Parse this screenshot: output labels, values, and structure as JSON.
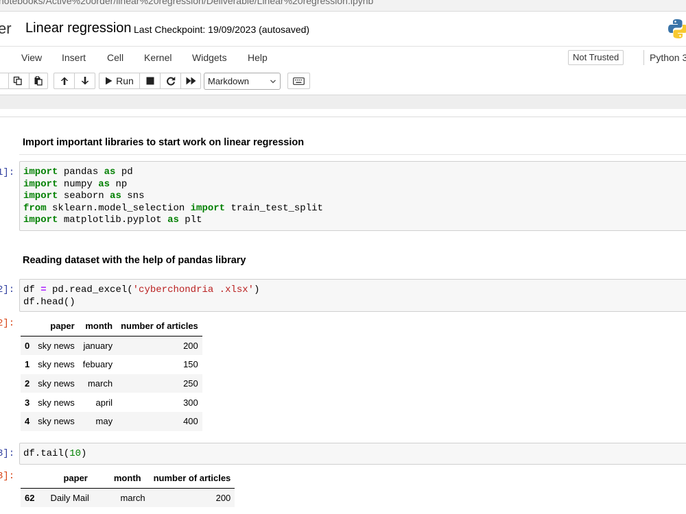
{
  "browser": {
    "url_path": "notebooks/Active%20order/linear%20regression/Deliverable/Linear%20regression.ipynb"
  },
  "header": {
    "logo_text": "er",
    "notebook_title": "Linear regression",
    "checkpoint": "Last Checkpoint: 19/09/2023  (autosaved)",
    "python_logo_icon": "python-logo-icon"
  },
  "menu": {
    "items": [
      "View",
      "Insert",
      "Cell",
      "Kernel",
      "Widgets",
      "Help"
    ],
    "trust_label": "Not Trusted",
    "kernel_label": "Python 3"
  },
  "toolbar": {
    "run_label": "Run",
    "cell_type": "Markdown",
    "icons": [
      "copy-icon",
      "paste-icon",
      "move-up-icon",
      "move-down-icon",
      "run-icon",
      "stop-icon",
      "restart-icon",
      "fast-forward-icon",
      "keyboard-icon"
    ]
  },
  "cells": {
    "md1": "Import important libraries to start work on linear regression",
    "in1_prompt": "1]:",
    "in1_code": [
      {
        "kw1": "import",
        "a": " pandas ",
        "kw2": "as",
        "b": " pd"
      },
      {
        "kw1": "import",
        "a": " numpy ",
        "kw2": "as",
        "b": " np"
      },
      {
        "kw1": "import",
        "a": " seaborn ",
        "kw2": "as",
        "b": " sns"
      },
      {
        "kw1": "from",
        "a": " sklearn.model_selection ",
        "kw2": "import",
        "b": " train_test_split"
      },
      {
        "kw1": "import",
        "a": " matplotlib.pyplot ",
        "kw2": "as",
        "b": " plt"
      }
    ],
    "md2": "Reading dataset with the help of pandas library",
    "in2_prompt": "2]:",
    "in2_line1": {
      "a": "df ",
      "op": "=",
      "b": " pd.read_excel(",
      "str": "'cyberchondria .xlsx'",
      "c": ")"
    },
    "in2_line2": "df.head()",
    "out2_prompt": "2]:",
    "out2_table": {
      "columns": [
        "paper",
        "month",
        "number of articles"
      ],
      "rows": [
        {
          "idx": "0",
          "paper": "sky news",
          "month": "january",
          "articles": "200"
        },
        {
          "idx": "1",
          "paper": "sky news",
          "month": "febuary",
          "articles": "150"
        },
        {
          "idx": "2",
          "paper": "sky news",
          "month": "march",
          "articles": "250"
        },
        {
          "idx": "3",
          "paper": "sky news",
          "month": "april",
          "articles": "300"
        },
        {
          "idx": "4",
          "paper": "sky news",
          "month": "may",
          "articles": "400"
        }
      ]
    },
    "in3_prompt": "3]:",
    "in3_code": {
      "a": "df.tail(",
      "num": "10",
      "b": ")"
    },
    "out3_prompt": "3]:",
    "out3_table": {
      "columns": [
        "paper",
        "month",
        "number of articles"
      ],
      "rows": [
        {
          "idx": "62",
          "paper": "Daily Mail",
          "month": "march",
          "articles": "200"
        }
      ]
    }
  }
}
